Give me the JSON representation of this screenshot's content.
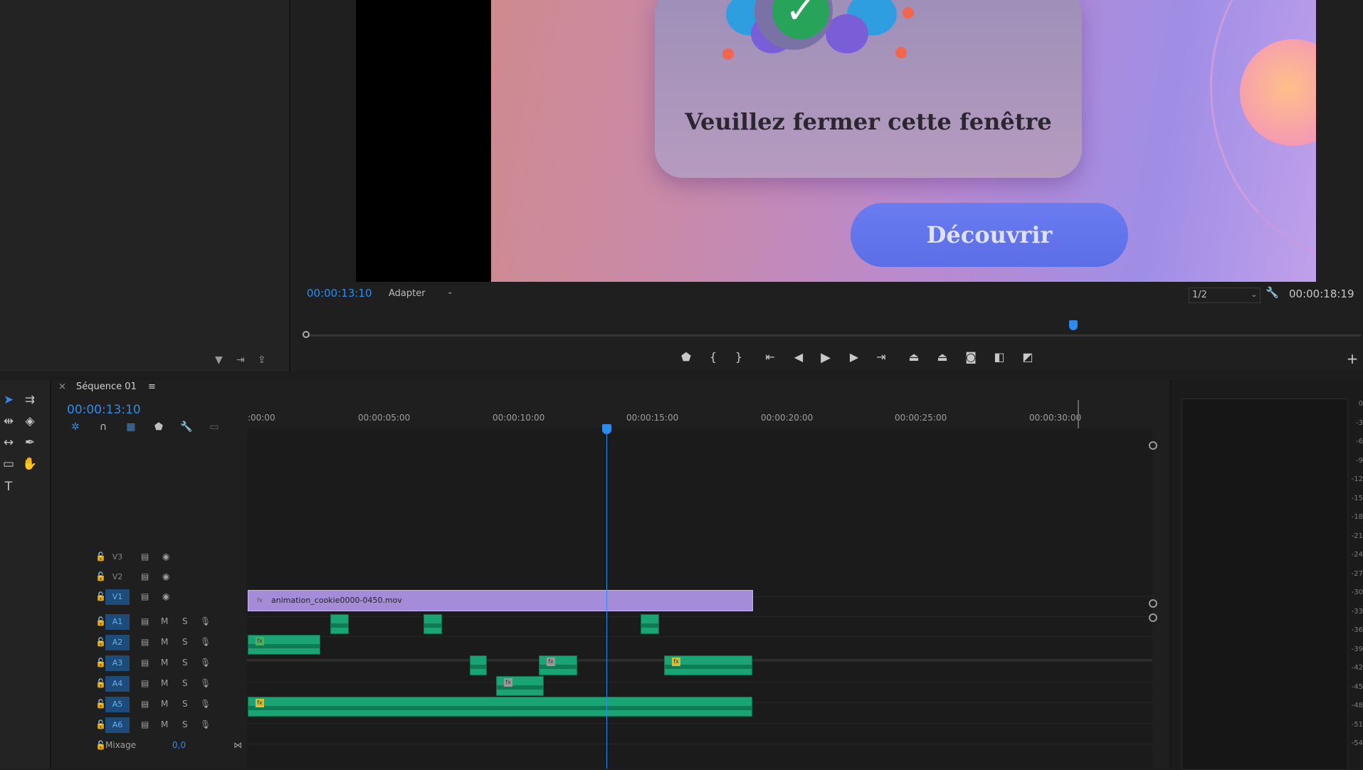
{
  "source_panel": {
    "filter_icon": "filter-icon",
    "insert_icon": "insert-icon",
    "export_icon": "export-icon"
  },
  "program": {
    "popup_message": "Veuillez fermer cette fenêtre",
    "discover_button": "Découvrir",
    "current_timecode": "00:00:13:10",
    "zoom": "Adapter",
    "resolution": "1/2",
    "duration": "00:00:18:19",
    "playhead_fraction": 0.727,
    "controls": [
      "marker-icon",
      "mark-in-icon",
      "mark-out-icon",
      "go-to-in-icon",
      "step-back-icon",
      "play-icon",
      "step-forward-icon",
      "go-to-out-icon",
      "lift-icon",
      "extract-icon",
      "camera-icon",
      "compare-icon",
      "overlay-icon"
    ],
    "add_label": "+"
  },
  "tools": [
    "selection-icon",
    "track-select-icon",
    "ripple-edit-icon",
    "razor-icon",
    "slip-icon",
    "pen-icon",
    "rectangle-icon",
    "hand-icon",
    "type-icon"
  ],
  "timeline": {
    "sequence_name": "Séquence 01",
    "timecode": "00:00:13:10",
    "ruler_labels": [
      ":00:00",
      "00:00:05:00",
      "00:00:10:00",
      "00:00:15:00",
      "00:00:20:00",
      "00:00:25:00",
      "00:00:30:00"
    ],
    "video_tracks": [
      {
        "name": "V3",
        "active": false
      },
      {
        "name": "V2",
        "active": false
      },
      {
        "name": "V1",
        "active": true
      }
    ],
    "audio_tracks": [
      {
        "name": "A1"
      },
      {
        "name": "A2"
      },
      {
        "name": "A3"
      },
      {
        "name": "A4"
      },
      {
        "name": "A5"
      },
      {
        "name": "A6"
      }
    ],
    "mute_label": "M",
    "solo_label": "S",
    "mix_label": "Mixage",
    "mix_value": "0,0",
    "v1_clip": "animation_cookie0000-0450.mov",
    "fx_label": "fx"
  },
  "meter": {
    "db_labels": [
      "0",
      "-3",
      "-6",
      "-9",
      "-12",
      "-15",
      "-18",
      "-21",
      "-24",
      "-27",
      "-30",
      "-33",
      "-36",
      "-39",
      "-42",
      "-45",
      "-48",
      "-51",
      "-54"
    ]
  },
  "colors": {
    "accent_blue": "#2d8ceb",
    "audio_clip": "#1aa474",
    "video_clip": "#a48cd8",
    "work_area": "#e6e03a"
  }
}
